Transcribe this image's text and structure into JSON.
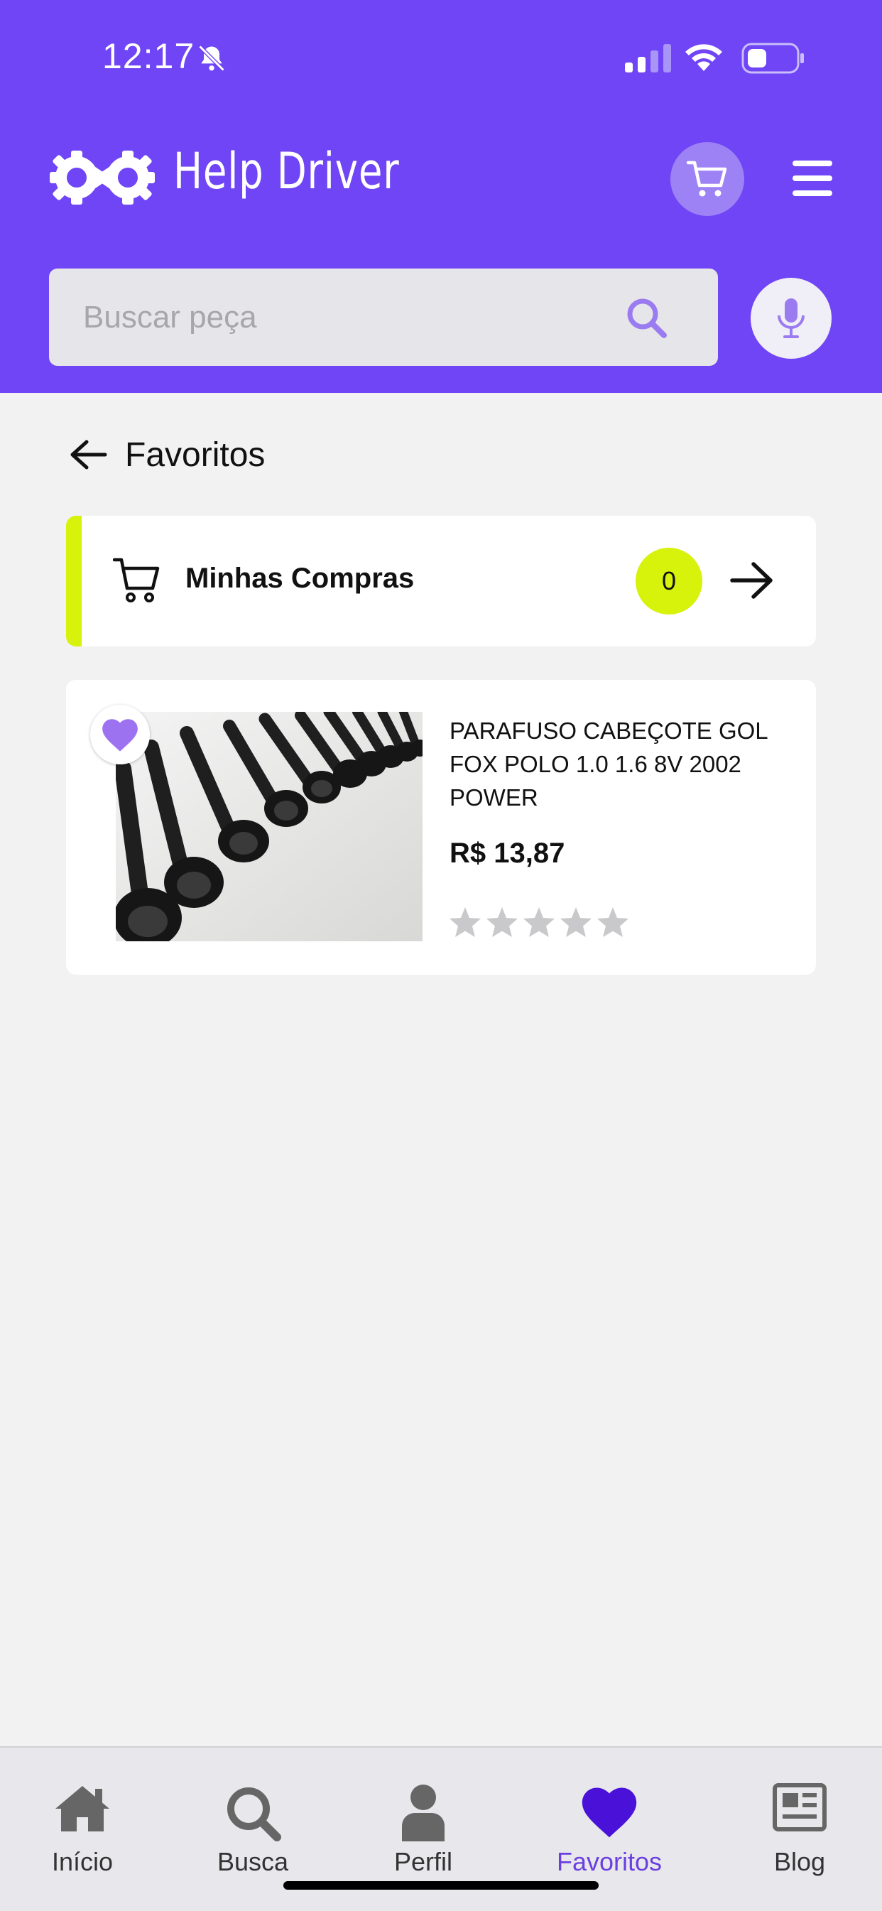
{
  "status_bar": {
    "time": "12:17"
  },
  "app": {
    "brand": "Help Driver"
  },
  "search": {
    "placeholder": "Buscar peça"
  },
  "page": {
    "title": "Favoritos"
  },
  "purchases": {
    "label": "Minhas Compras",
    "count": "0"
  },
  "product": {
    "name": "PARAFUSO CABEÇOTE GOL FOX POLO 1.0 1.6 8V 2002 POWER",
    "price": "R$ 13,87",
    "rating": 0,
    "rating_max": 5,
    "favorited": true
  },
  "tabs": [
    {
      "label": "Início",
      "icon": "home-icon",
      "active": false
    },
    {
      "label": "Busca",
      "icon": "search-icon",
      "active": false
    },
    {
      "label": "Perfil",
      "icon": "person-icon",
      "active": false
    },
    {
      "label": "Favoritos",
      "icon": "heart-icon",
      "active": true
    },
    {
      "label": "Blog",
      "icon": "newspaper-icon",
      "active": false
    }
  ],
  "colors": {
    "brand": "#6f45f5",
    "accent": "#d7f20b",
    "active_tab": "#6b3fe0",
    "favorite": "#9d72f0"
  }
}
